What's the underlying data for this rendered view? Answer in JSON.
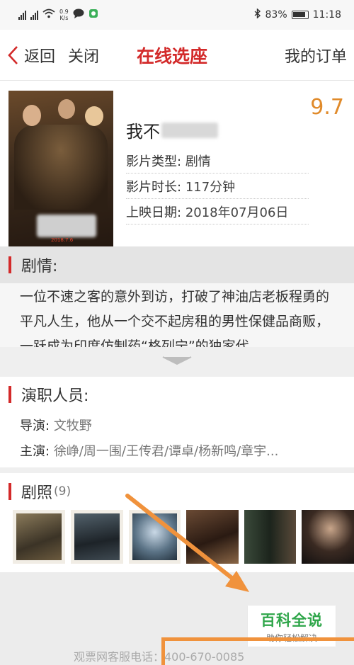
{
  "status_bar": {
    "signal1": "46",
    "signal2": "46",
    "net_speed": "0.9",
    "net_unit": "K/s",
    "battery": "83%",
    "time": "11:18"
  },
  "nav": {
    "back_label": "返回",
    "close_label": "关闭",
    "title": "在线选座",
    "orders_label": "我的订单"
  },
  "movie": {
    "score": "9.7",
    "title_visible": "我不",
    "type_label": "影片类型:",
    "type_value": "剧情",
    "duration_label": "影片时长:",
    "duration_value": "117分钟",
    "release_label": "上映日期:",
    "release_value": "2018年07月06日",
    "poster_date": "2018.7.6"
  },
  "synopsis": {
    "heading": "剧情:",
    "text": "一位不速之客的意外到访，打破了神油店老板程勇的平凡人生，他从一个交不起房租的男性保健品商贩，一跃成为印度仿制药“格列宁”的独家代"
  },
  "cast": {
    "heading": "演职人员:",
    "director_label": "导演:",
    "director_value": "文牧野",
    "actors_label": "主演:",
    "actors_value": "徐峥/周一围/王传君/谭卓/杨新鸣/章宇..."
  },
  "stills": {
    "heading": "剧照",
    "count": "(9)",
    "items": [
      "still-1",
      "still-2",
      "still-3",
      "still-4",
      "still-5",
      "still-6"
    ]
  },
  "footer": {
    "hotline": "观票网客服电话：400-670-0085"
  },
  "watermark": {
    "main": "百科全说",
    "sub": "助你轻松解决"
  },
  "colors": {
    "accent_red": "#d32a2a",
    "score_orange": "#e08a2a",
    "annotation_orange": "#f0923c",
    "logo_green": "#2fa64a"
  }
}
